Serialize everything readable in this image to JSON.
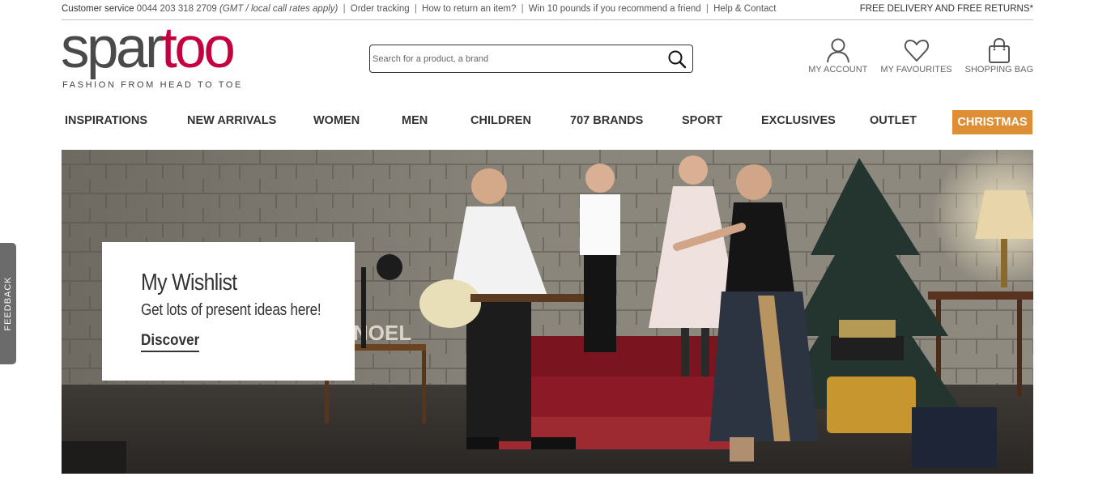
{
  "topbar": {
    "customer_service_label": "Customer service",
    "phone": "0044 203 318 2709",
    "phone_note": "(GMT / local call rates apply)",
    "separator": "|",
    "links": [
      "Order tracking",
      "How to return an item?",
      "Win 10 pounds if you recommend a friend",
      "Help & Contact"
    ],
    "delivery_notice": "FREE DELIVERY AND FREE RETURNS*"
  },
  "logo": {
    "part1": "spar",
    "part2": "too",
    "tagline": "FASHION FROM HEAD TO TOE",
    "colors": {
      "part1": "#4a4a4a",
      "part2": "#c4003e"
    }
  },
  "search": {
    "placeholder": "Search for a product, a brand",
    "value": "",
    "icon": "search-icon"
  },
  "account_links": [
    {
      "label": "MY ACCOUNT",
      "icon": "user-icon"
    },
    {
      "label": "MY FAVOURITES",
      "icon": "heart-icon"
    },
    {
      "label": "SHOPPING BAG",
      "icon": "shopping-bag-icon"
    }
  ],
  "nav": {
    "items": [
      "INSPIRATIONS",
      "NEW ARRIVALS",
      "WOMEN",
      "MEN",
      "CHILDREN",
      "707 BRANDS",
      "SPORT",
      "EXCLUSIVES",
      "OUTLET"
    ],
    "highlight": "CHRISTMAS",
    "highlight_color": "#de8f36"
  },
  "hero": {
    "promo_title": "My Wishlist",
    "promo_subtitle": "Get lots of present ideas here!",
    "promo_cta": "Discover",
    "image_text": "NOEL"
  },
  "feedback": {
    "label": "FEEDBACK"
  }
}
